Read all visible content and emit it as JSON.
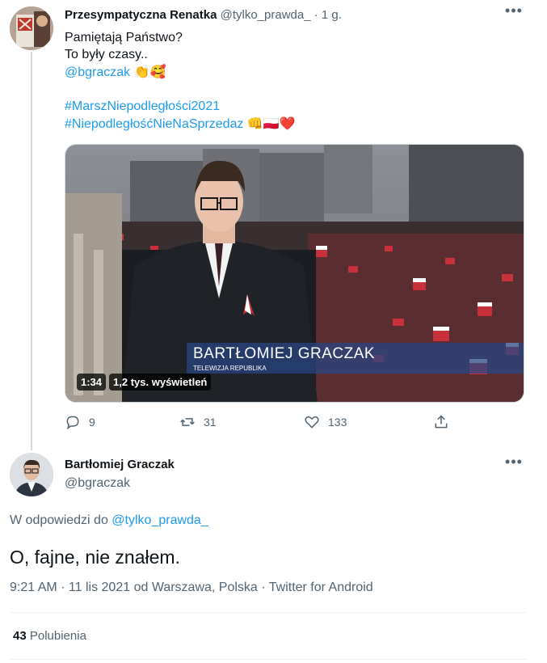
{
  "tweet1": {
    "author_name": "Przesympatyczna Renatka",
    "handle": "@tylko_prawda_",
    "separator": "·",
    "time": "1 g.",
    "lines": [
      {
        "text": "Pamiętają Państwo?",
        "type": "text"
      },
      {
        "text": "To były czasy..",
        "type": "text"
      },
      {
        "text": "@bgraczak",
        "type": "link",
        "emoji": "👏🥰"
      },
      {
        "text": "",
        "type": "blank"
      },
      {
        "text": "#MarszNiepodległości2021",
        "type": "link"
      },
      {
        "text": "#NiepodległośćNieNaSprzedaz",
        "type": "link",
        "emoji": "👊🇵🇱❤️"
      }
    ],
    "video": {
      "lower_third_name": "BARTŁOMIEJ GRACZAK",
      "lower_third_channel": "TELEWIZJA REPUBLIKA",
      "duration": "1:34",
      "views": "1,2 tys. wyświetleń"
    },
    "actions": {
      "replies": "9",
      "retweets": "31",
      "likes": "133"
    }
  },
  "tweet2": {
    "author_name": "Bartłomiej Graczak",
    "handle": "@bgraczak",
    "reply_prefix": "W odpowiedzi do",
    "reply_handle": "@tylko_prawda_",
    "text": "O, fajne, nie znałem.",
    "meta": "9:21 AM · 11 lis 2021 od Warszawa, Polska · Twitter for Android",
    "likes_count": "43",
    "likes_label": "Polubienia"
  },
  "colors": {
    "accent": "#1d9bf0",
    "secondary_text": "#536471",
    "primary_text": "#0f1419",
    "border": "#cfd9de"
  }
}
